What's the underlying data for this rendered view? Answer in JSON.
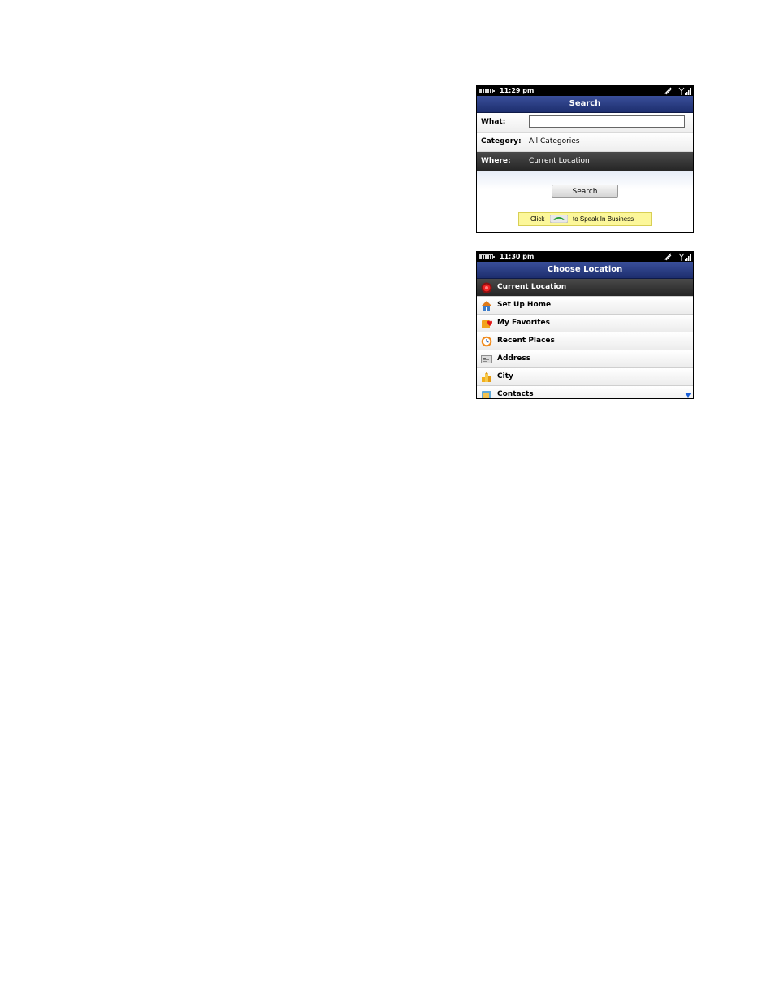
{
  "search_screen": {
    "status": {
      "time": "11:29 pm"
    },
    "title": "Search",
    "fields": [
      {
        "label": "What:",
        "value": ""
      },
      {
        "label": "Category:",
        "value": "All Categories"
      },
      {
        "label": "Where:",
        "value": "Current Location"
      }
    ],
    "search_button": "Search",
    "hint": {
      "click": "Click",
      "icon": "green-phone-icon",
      "rest": "to Speak In Business"
    }
  },
  "location_screen": {
    "status": {
      "time": "11:30 pm"
    },
    "title": "Choose Location",
    "items": [
      {
        "label": "Current Location",
        "icon": "gps-target-icon"
      },
      {
        "label": "Set Up Home",
        "icon": "house-icon"
      },
      {
        "label": "My Favorites",
        "icon": "heart-star-icon"
      },
      {
        "label": "Recent Places",
        "icon": "clock-icon"
      },
      {
        "label": "Address",
        "icon": "address-card-icon"
      },
      {
        "label": "City",
        "icon": "city-buildings-icon"
      },
      {
        "label": "Contacts",
        "icon": "contacts-icon"
      }
    ]
  },
  "colors": {
    "titlebar": "#2a3d85",
    "selected_row": "#333333",
    "hint_background": "#fcf79a"
  }
}
